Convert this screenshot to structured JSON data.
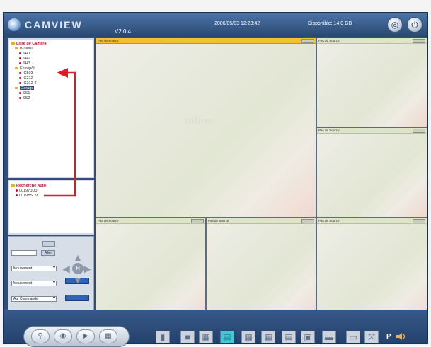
{
  "header": {
    "brand": "CAMVIEW",
    "version": "V2.0.4",
    "datetime": "2006/05/03 12:23:42",
    "disk": "Disponible: 14,0 GB",
    "settings_icon": "settings-dial-icon",
    "power_icon": "power-icon"
  },
  "camera_list": {
    "root": "Liste de Caméra",
    "groups": [
      {
        "name": "Bureau",
        "items": [
          "SH1",
          "SH2",
          "SH3"
        ]
      },
      {
        "name": "Entrepôt",
        "items": [
          "IC503",
          "IC212",
          "IC212-2"
        ]
      },
      {
        "name": "Garage",
        "items": [
          "SS1",
          "SS2"
        ]
      }
    ]
  },
  "search": {
    "root": "Recherche Auto",
    "items": [
      "001970D0",
      "0019B5D9"
    ]
  },
  "controls": {
    "go_label": "Aller",
    "select1": "Mouvement",
    "select2": "Mouvement",
    "select3": "Au: Commande",
    "center_label": "H"
  },
  "tiles": {
    "label": "Pas de Source",
    "watermark": "inline"
  },
  "toolbar": {
    "speaker_label": "P"
  },
  "colors": {
    "frame": "#2f4f78",
    "active_tile": "#f2c12d",
    "active_layout": "#42c7d6",
    "annotation_arrow": "#e01a22"
  }
}
